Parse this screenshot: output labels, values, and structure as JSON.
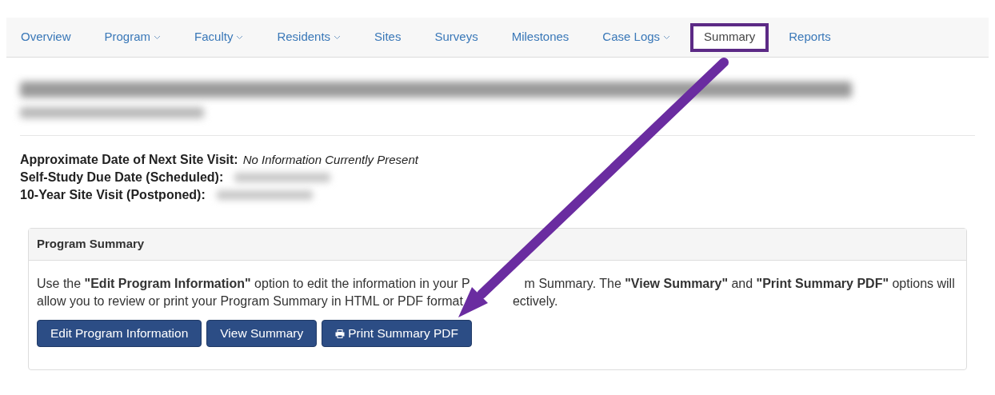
{
  "nav": [
    {
      "label": "Overview",
      "dropdown": false,
      "selected": false
    },
    {
      "label": "Program",
      "dropdown": true,
      "selected": false
    },
    {
      "label": "Faculty",
      "dropdown": true,
      "selected": false
    },
    {
      "label": "Residents",
      "dropdown": true,
      "selected": false
    },
    {
      "label": "Sites",
      "dropdown": false,
      "selected": false
    },
    {
      "label": "Surveys",
      "dropdown": false,
      "selected": false
    },
    {
      "label": "Milestones",
      "dropdown": false,
      "selected": false
    },
    {
      "label": "Case Logs",
      "dropdown": true,
      "selected": false
    },
    {
      "label": "Summary",
      "dropdown": false,
      "selected": true
    },
    {
      "label": "Reports",
      "dropdown": false,
      "selected": false
    }
  ],
  "dates": [
    {
      "label": "Approximate Date of Next Site Visit:",
      "kind": "text",
      "value": "No Information Currently Present"
    },
    {
      "label": "Self-Study Due Date (Scheduled):",
      "kind": "redacted"
    },
    {
      "label": "10-Year Site Visit (Postponed):",
      "kind": "redacted"
    }
  ],
  "panel": {
    "title": "Program Summary",
    "description_lines": [
      [
        "Use the **\"Edit Program Information\"** option to edit the information in your P",
        "m Summary. The **\"View Summary\"** and **\"Print Summary PDF\"** options will"
      ],
      [
        "allow you to review or print your Program Summary in HTML or PDF format",
        "ectively."
      ]
    ],
    "buttons": [
      {
        "label": "Edit Program Information",
        "kind": "plain"
      },
      {
        "label": "View Summary",
        "kind": "plain"
      },
      {
        "label": "Print Summary PDF",
        "kind": "print"
      }
    ]
  }
}
